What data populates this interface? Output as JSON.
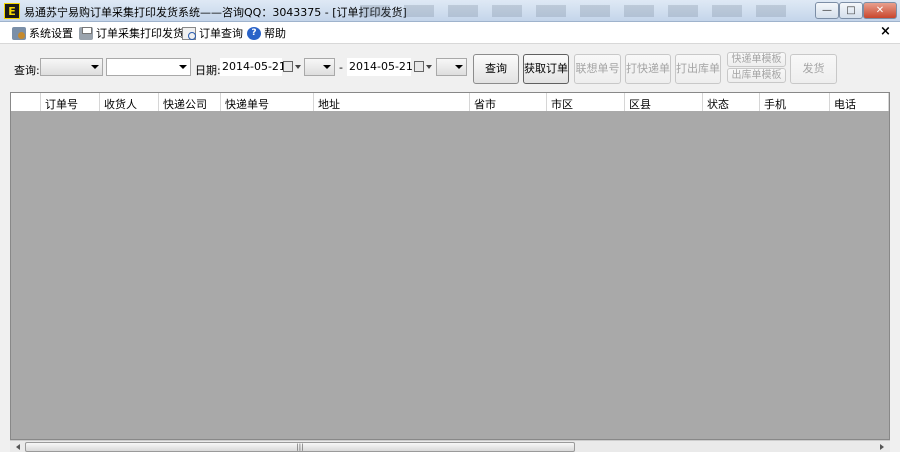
{
  "window": {
    "title": "易通苏宁易购订单采集打印发货系统——咨询QQ：3043375 - [订单打印发货]",
    "app_icon_text": "E",
    "min_glyph": "—",
    "max_glyph": "□",
    "close_glyph": "✕"
  },
  "menu": {
    "items": [
      {
        "label": "系统设置",
        "icon": "gear-icon"
      },
      {
        "label": "订单采集打印发货",
        "icon": "printer-icon"
      },
      {
        "label": "订单查询",
        "icon": "search-doc-icon"
      },
      {
        "label": "帮助",
        "icon": "help-icon"
      }
    ],
    "close_glyph": "×"
  },
  "toolbar": {
    "query_label": "查询:",
    "date_label": "日期:",
    "date_from": "2014-05-21",
    "date_separator": "-",
    "date_to": "2014-05-21",
    "buttons": {
      "query": "查询",
      "fetch_orders": "获取订单",
      "associate_number": "联想单号",
      "print_express": "打快递单",
      "print_outbound": "打出库单",
      "express_template": "快递单模板",
      "outbound_template": "出库单模板",
      "ship": "发货"
    }
  },
  "grid": {
    "columns": [
      "订单号",
      "收货人",
      "快递公司",
      "快递单号",
      "地址",
      "省市",
      "市区",
      "区县",
      "状态",
      "手机",
      "电话"
    ]
  },
  "scrollbar": {
    "thumb_grip": "|||"
  }
}
